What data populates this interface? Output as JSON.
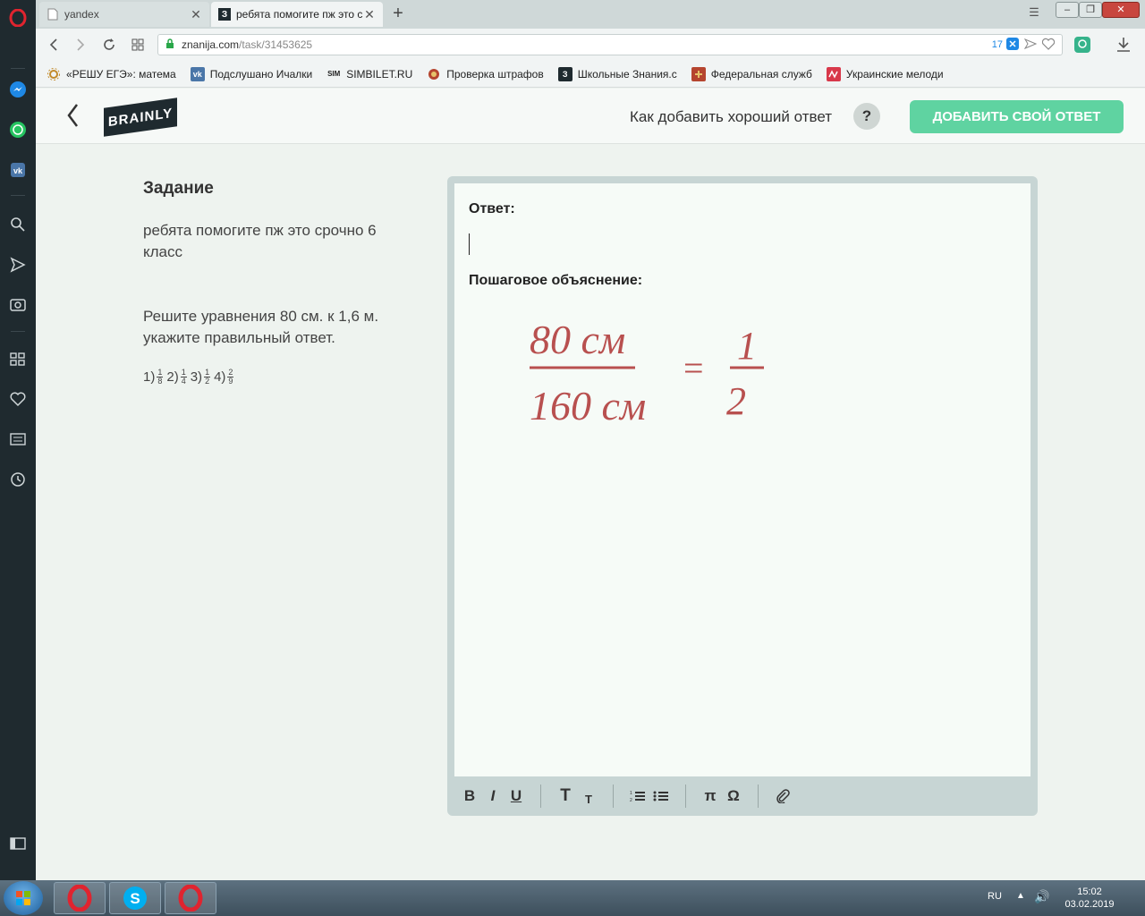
{
  "browser": {
    "tabs": [
      {
        "title": "yandex"
      },
      {
        "title": "ребята помогите пж это с"
      }
    ],
    "url_domain": "znanija.com",
    "url_path": "/task/31453625",
    "notification_count": "17",
    "bookmarks": [
      {
        "label": "«РЕШУ ЕГЭ»: матема",
        "icon": "solar-icon"
      },
      {
        "label": "Подслушано Ичалки",
        "icon": "vk-icon"
      },
      {
        "label": "SIMBILET.RU",
        "icon": "sim-icon"
      },
      {
        "label": "Проверка штрафов",
        "icon": "emblem-icon"
      },
      {
        "label": "Школьные Знания.c",
        "icon": "znanija-icon"
      },
      {
        "label": "Федеральная служб",
        "icon": "cross-icon"
      },
      {
        "label": "Украинские мелоди",
        "icon": "wave-icon"
      }
    ]
  },
  "header": {
    "logo": "BRAINLY",
    "howto": "Как добавить хороший ответ",
    "help": "?",
    "add_answer": "ДОБАВИТЬ СВОЙ ОТВЕТ"
  },
  "task": {
    "heading": "Задание",
    "line1": "ребята помогите пж это срочно 6 класс",
    "line2": "Решите уравнения 80 см. к 1,6 м. укажите правильный ответ.",
    "options": [
      {
        "prefix": "1)",
        "num": "1",
        "den": "8"
      },
      {
        "prefix": "2)",
        "num": "1",
        "den": "4"
      },
      {
        "prefix": "3)",
        "num": "1",
        "den": "2"
      },
      {
        "prefix": "4)",
        "num": "2",
        "den": "9"
      }
    ]
  },
  "editor": {
    "answer_label": "Ответ:",
    "explain_label": "Пошаговое объяснение:",
    "handwriting": {
      "numerator": "80 см",
      "denominator": "160 см",
      "equals": "=",
      "result_num": "1",
      "result_den": "2",
      "ink_color": "#b8504f"
    },
    "toolbar": [
      "B",
      "I",
      "U",
      "T",
      "T",
      "π",
      "Ω"
    ]
  },
  "taskbar": {
    "lang": "RU",
    "time": "15:02",
    "date": "03.02.2019"
  }
}
